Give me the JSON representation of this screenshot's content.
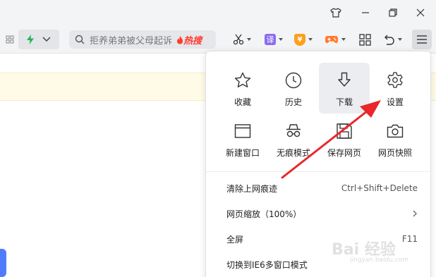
{
  "search": {
    "query": "拒养弟弟被父母起诉",
    "hot_label": "热搜"
  },
  "toolbar": {
    "translate_label": "译",
    "coin_label": "¥"
  },
  "menu": {
    "grid": [
      {
        "label": "收藏",
        "icon": "star-icon"
      },
      {
        "label": "历史",
        "icon": "clock-icon"
      },
      {
        "label": "下载",
        "icon": "download-icon"
      },
      {
        "label": "设置",
        "icon": "gear-icon"
      },
      {
        "label": "新建窗口",
        "icon": "window-icon"
      },
      {
        "label": "无痕模式",
        "icon": "incognito-icon"
      },
      {
        "label": "保存网页",
        "icon": "save-icon"
      },
      {
        "label": "网页快照",
        "icon": "camera-icon"
      }
    ],
    "list": [
      {
        "label": "清除上网痕迹",
        "shortcut": "Ctrl+Shift+Delete"
      },
      {
        "label": "网页缩放（100%）",
        "shortcut": ""
      },
      {
        "label": "全屏",
        "shortcut": "F11"
      },
      {
        "label": "切换到IE6多窗口模式",
        "shortcut": ""
      }
    ]
  },
  "watermark": {
    "main": "Bai 经验",
    "sub": "jingyan.baidu.com"
  },
  "colors": {
    "accent_red": "#e8262b",
    "hot_red": "#ff3b2f",
    "blue_tab": "#4f7cff",
    "notice_yellow": "#fffbe7"
  }
}
